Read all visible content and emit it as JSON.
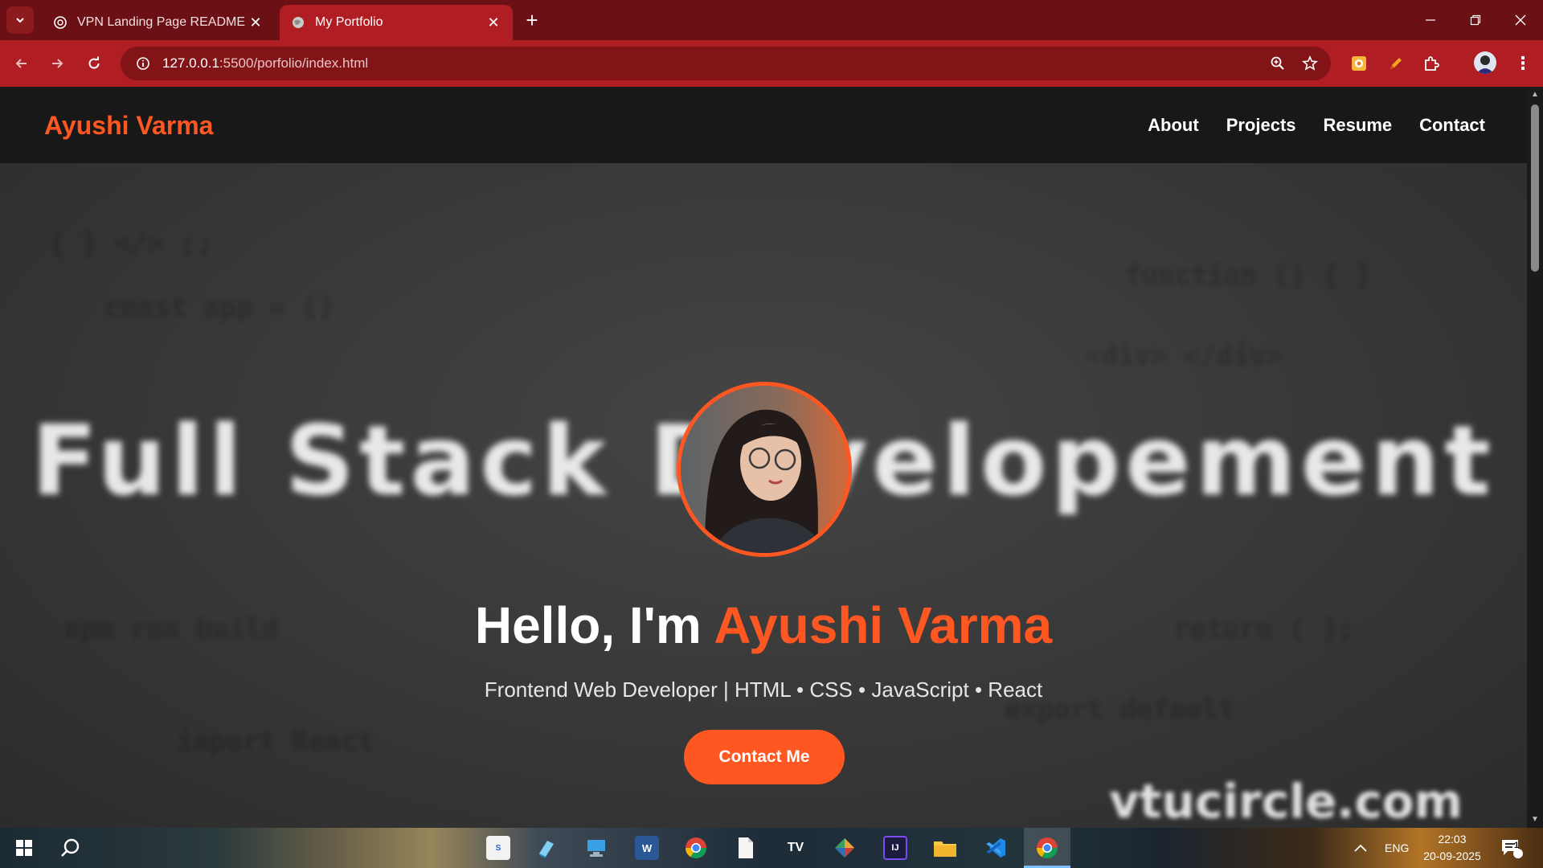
{
  "browser": {
    "tabs": [
      {
        "label": "VPN Landing Page README",
        "active": false
      },
      {
        "label": "My Portfolio",
        "active": true
      }
    ],
    "url_host": "127.0.0.1",
    "url_rest": ":5500/porfolio/index.html"
  },
  "site": {
    "logo": "Ayushi Varma",
    "nav": [
      "About",
      "Projects",
      "Resume",
      "Contact"
    ],
    "background_text": "Full Stack Developement",
    "watermark": "vtucircle.com",
    "hero": {
      "greeting": "Hello, I'm ",
      "name": "Ayushi Varma",
      "subtitle": "Frontend Web Developer | HTML • CSS • JavaScript • React",
      "cta": "Contact Me"
    },
    "accent_color": "#ff5722"
  },
  "taskbar": {
    "language": "ENG",
    "time": "22:03",
    "date": "20-09-2025",
    "notification_count": "1",
    "apps": [
      "skype-app",
      "notepad-app",
      "remote-desktop-app",
      "word-app",
      "chrome-app",
      "file-app",
      "tradingview-app",
      "git-app",
      "intellij-app",
      "file-explorer-app",
      "vscode-app",
      "chrome-active-app"
    ]
  }
}
